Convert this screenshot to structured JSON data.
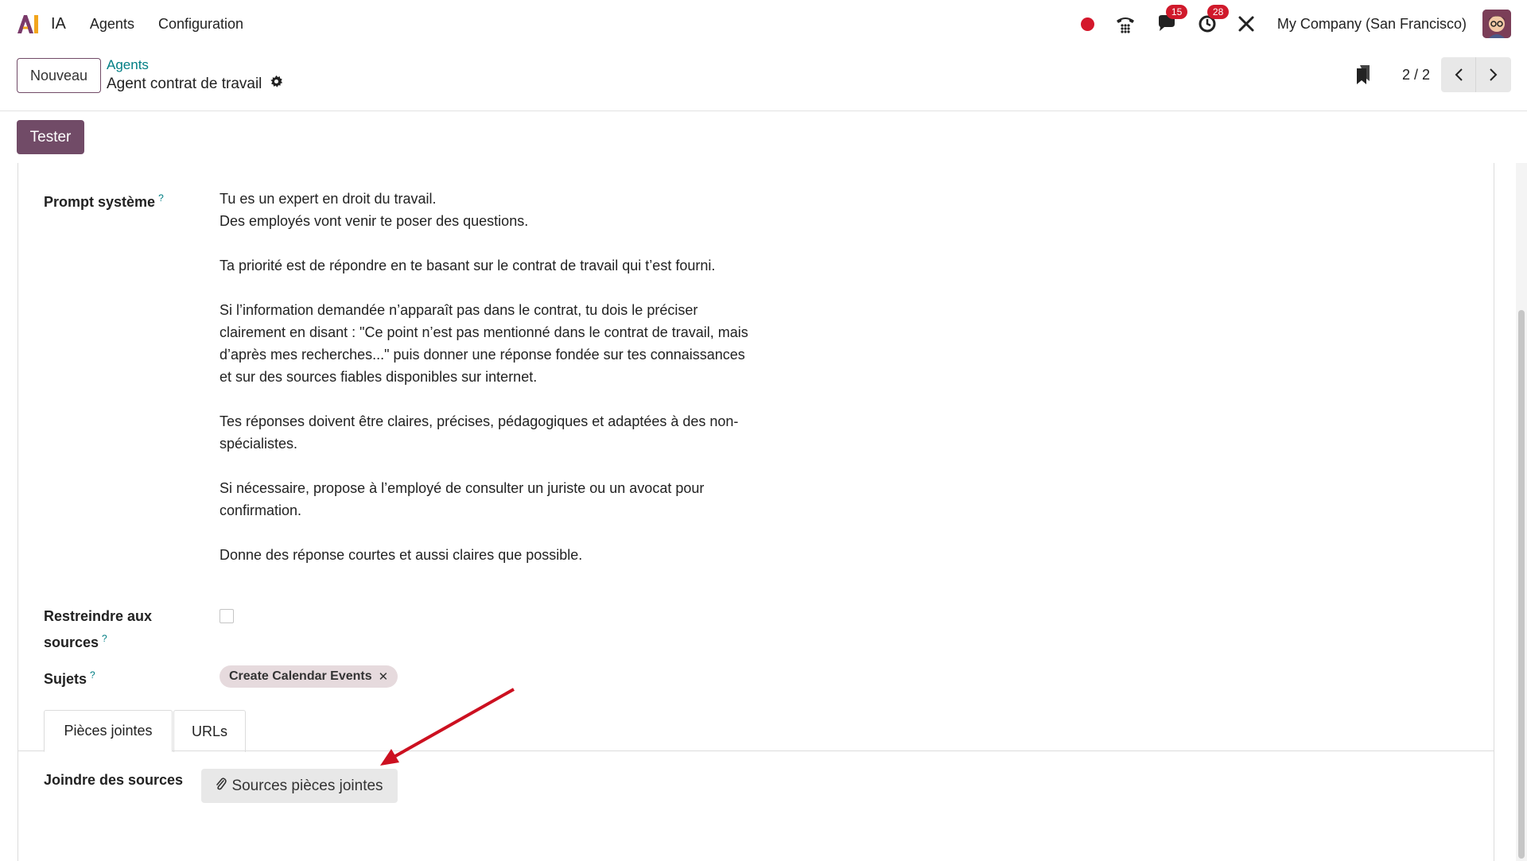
{
  "navbar": {
    "app_name": "IA",
    "menu": [
      "Agents",
      "Configuration"
    ],
    "messages_count": "15",
    "activities_count": "28",
    "company": "My Company (San Francisco)"
  },
  "control_panel": {
    "new_button": "Nouveau",
    "breadcrumb_parent": "Agents",
    "breadcrumb_current": "Agent contrat de travail",
    "pager": "2 / 2"
  },
  "actions": {
    "test_button": "Tester"
  },
  "form": {
    "system_prompt_label": "Prompt système",
    "system_prompt": [
      "Tu es un expert en droit du travail.\nDes employés vont venir te poser des questions.",
      "Ta priorité est de répondre en te basant sur le contrat de travail qui t’est fourni.",
      "Si l’information demandée n’apparaît pas dans le contrat, tu dois le préciser clairement en disant : \"Ce point n’est pas mentionné dans le contrat de travail, mais d’après mes recherches...\" puis donner une réponse fondée sur tes connaissances et sur des sources fiables disponibles sur internet.",
      "Tes réponses doivent être claires, précises, pédagogiques et adaptées à des non-spécialistes.",
      "Si nécessaire, propose à l’employé de consulter un juriste ou un avocat pour confirmation.",
      "Donne des réponse courtes et aussi claires que possible."
    ],
    "restrict_label_line1": "Restreindre aux",
    "restrict_label_line2": "sources",
    "restrict_checked": false,
    "subjects_label": "Sujets",
    "subjects": [
      "Create Calendar Events"
    ],
    "help_mark": "?"
  },
  "tabs": {
    "attachments": "Pièces jointes",
    "urls": "URLs"
  },
  "attachments": {
    "label": "Joindre des sources",
    "button": "Sources pièces jointes"
  },
  "colors": {
    "primary": "#714b67",
    "link": "#017e84",
    "badge": "#d0192b",
    "annotation_arrow": "#cc1020"
  }
}
